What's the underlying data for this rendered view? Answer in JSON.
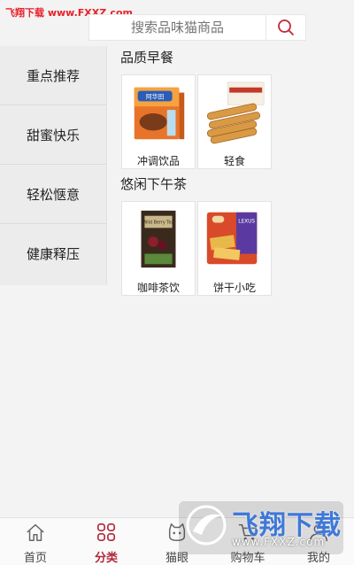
{
  "watermark_top": "飞翔下载 www.FXXZ.com",
  "search": {
    "placeholder": "搜索品味猫商品"
  },
  "sidebar": {
    "items": [
      {
        "label": "重点推荐"
      },
      {
        "label": "甜蜜快乐"
      },
      {
        "label": "轻松惬意"
      },
      {
        "label": "健康释压"
      }
    ]
  },
  "sections": [
    {
      "title": "品质早餐",
      "products": [
        {
          "label": "冲调饮品",
          "image": "cereal-drink-box",
          "product_text": "阿华田"
        },
        {
          "label": "轻食",
          "image": "wafer-rolls"
        }
      ]
    },
    {
      "title": "悠闲下午茶",
      "products": [
        {
          "label": "咖啡茶饮",
          "image": "tea-box",
          "product_text": "Wild Berry Tea"
        },
        {
          "label": "饼干小吃",
          "image": "biscuit-pack",
          "product_text": "LEXUS"
        }
      ]
    }
  ],
  "bottom_nav": [
    {
      "label": "首页",
      "icon": "home-icon"
    },
    {
      "label": "分类",
      "icon": "category-icon",
      "active": true
    },
    {
      "label": "猫眼",
      "icon": "cat-icon"
    },
    {
      "label": "购物车",
      "icon": "cart-icon"
    },
    {
      "label": "我的",
      "icon": "user-icon"
    }
  ],
  "watermark_bottom": {
    "title": "飞翔下载",
    "url": "www.FXXZ.com"
  },
  "colors": {
    "accent": "#b0283a",
    "watermark_red": "#e8202a",
    "watermark_blue": "#3f78d8"
  }
}
